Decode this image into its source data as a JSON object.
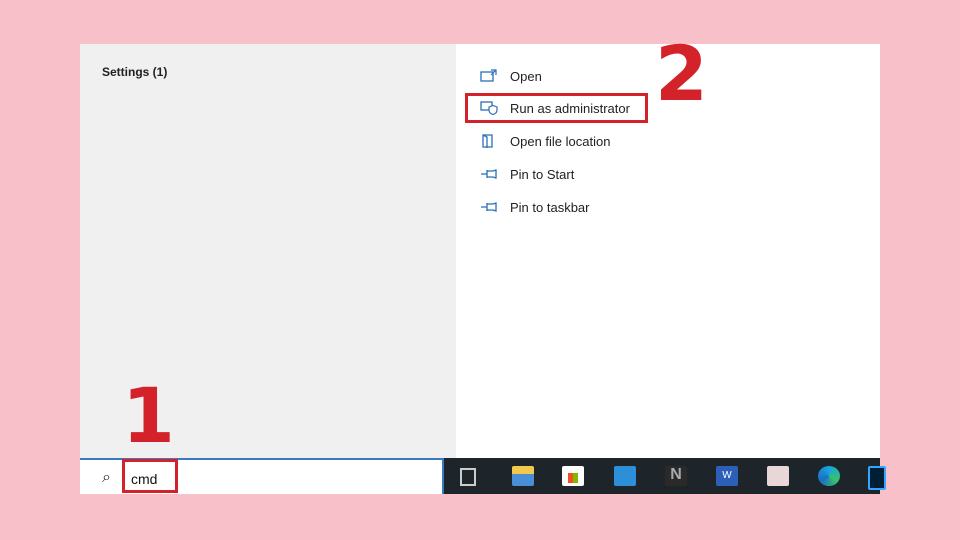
{
  "left_pane": {
    "section_title": "Settings (1)"
  },
  "context_menu": {
    "items": [
      {
        "label": "Open",
        "icon": "open-window-icon"
      },
      {
        "label": "Run as administrator",
        "icon": "shield-window-icon"
      },
      {
        "label": "Open file location",
        "icon": "folder-location-icon"
      },
      {
        "label": "Pin to Start",
        "icon": "pin-icon"
      },
      {
        "label": "Pin to taskbar",
        "icon": "pin-icon"
      }
    ]
  },
  "search": {
    "value": "cmd",
    "icon": "search-icon"
  },
  "taskbar": {
    "icons": [
      "task-view-icon",
      "file-explorer-icon",
      "microsoft-store-icon",
      "mail-icon",
      "notion-icon",
      "word-icon",
      "app-icon",
      "edge-icon",
      "photoshop-icon"
    ]
  },
  "annotations": {
    "step1": "1",
    "step2": "2",
    "highlight_color": "#d3222a"
  }
}
